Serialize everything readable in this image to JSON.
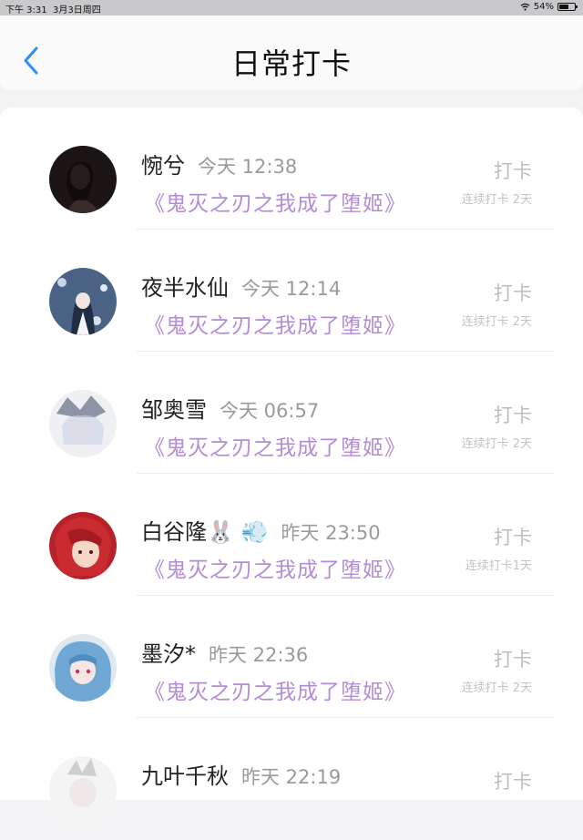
{
  "status_bar": {
    "time": "下午 3:31",
    "date": "3月3日周四",
    "battery": "54%",
    "wifi_icon": "wifi-icon",
    "battery_icon": "battery-icon"
  },
  "header": {
    "title": "日常打卡",
    "back_icon": "chevron-left-icon",
    "accent": "#2f8ff7"
  },
  "list": {
    "items": [
      {
        "name": "惋兮",
        "time": "今天 12:38",
        "book": "《鬼灭之刃之我成了堕姬》",
        "action": "打卡",
        "streak": "连续打卡 2天",
        "avatar": "avatar-dark"
      },
      {
        "name": "夜半水仙",
        "time": "今天 12:14",
        "book": "《鬼灭之刃之我成了堕姬》",
        "action": "打卡",
        "streak": "连续打卡 2天",
        "avatar": "avatar-blue"
      },
      {
        "name": "邹奥雪",
        "time": "今天 06:57",
        "book": "《鬼灭之刃之我成了堕姬》",
        "action": "打卡",
        "streak": "连续打卡 2天",
        "avatar": "avatar-light"
      },
      {
        "name": "白谷隆🐰 💨",
        "time": "昨天 23:50",
        "book": "《鬼灭之刃之我成了堕姬》",
        "action": "打卡",
        "streak": "连续打卡1天",
        "avatar": "avatar-red"
      },
      {
        "name": "墨汐*",
        "time": "昨天 22:36",
        "book": "《鬼灭之刃之我成了堕姬》",
        "action": "打卡",
        "streak": "连续打卡 2天",
        "avatar": "avatar-cyan"
      },
      {
        "name": "九叶千秋",
        "time": "昨天 22:19",
        "book": "",
        "action": "打卡",
        "streak": "",
        "avatar": "avatar-partial"
      }
    ]
  },
  "colors": {
    "book_title": "#b38bd6",
    "muted": "#9a9a9a",
    "checkin": "#bdbdbd"
  }
}
